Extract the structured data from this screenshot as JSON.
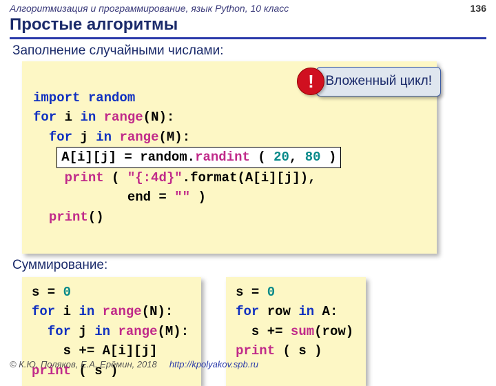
{
  "header": {
    "course": "Алгоритмизация и программирование, язык Python, 10 класс",
    "page": "136"
  },
  "title": "Простые алгоритмы",
  "sections": {
    "fill": "Заполнение случайными числами:",
    "sum": "Суммирование:"
  },
  "callout": {
    "mark": "!",
    "text": "Вложенный цикл!"
  },
  "code_main": {
    "l1_kw1": "import",
    "l1_kw2": "random",
    "l2_kw1": "for",
    "l2_i": " i ",
    "l2_kw2": "in",
    "l2_sp": " ",
    "l2_fn": "range",
    "l2_tail": "(N):",
    "l3_pad": "  ",
    "l3_kw1": "for",
    "l3_j": " j ",
    "l3_kw2": "in",
    "l3_sp": " ",
    "l3_fn": "range",
    "l3_tail": "(M):",
    "hl_a": "A[i][j] = random.",
    "hl_fn": "randint",
    "hl_open": " ( ",
    "hl_n1": "20",
    "hl_comma": ", ",
    "hl_n2": "80",
    "hl_close": " )",
    "l5_pad": "    ",
    "l5_fn": "print",
    "l5_open": " ( ",
    "l5_str": "\"{:4d}\"",
    "l5_tail": ".format(A[i][j]),",
    "l6_pad": "            ",
    "l6_end": "end = ",
    "l6_q": "\"\"",
    "l6_close": " )",
    "l7_pad": "  ",
    "l7_fn": "print",
    "l7_tail": "()"
  },
  "code_left": {
    "l1_a": "s = ",
    "l1_n": "0",
    "l2_kw1": "for",
    "l2_i": " i ",
    "l2_kw2": "in",
    "l2_sp": " ",
    "l2_fn": "range",
    "l2_tail": "(N):",
    "l3_pad": "  ",
    "l3_kw1": "for",
    "l3_j": " j ",
    "l3_kw2": "in",
    "l3_sp": " ",
    "l3_fn": "range",
    "l3_tail": "(M):",
    "l4": "    s += A[i][j]",
    "l5_fn": "print",
    "l5_tail": " ( s )"
  },
  "code_right": {
    "l1_a": "s = ",
    "l1_n": "0",
    "l2_kw1": "for",
    "l2_row": " row ",
    "l2_kw2": "in",
    "l2_tail": " A:",
    "l3_a": "  s += ",
    "l3_fn": "sum",
    "l3_tail": "(row)",
    "l4_fn": "print",
    "l4_tail": " ( s )"
  },
  "footer": {
    "copyright": "© К.Ю. Поляков, Е.А. Ерёмин, 2018",
    "url": "http://kpolyakov.spb.ru"
  }
}
